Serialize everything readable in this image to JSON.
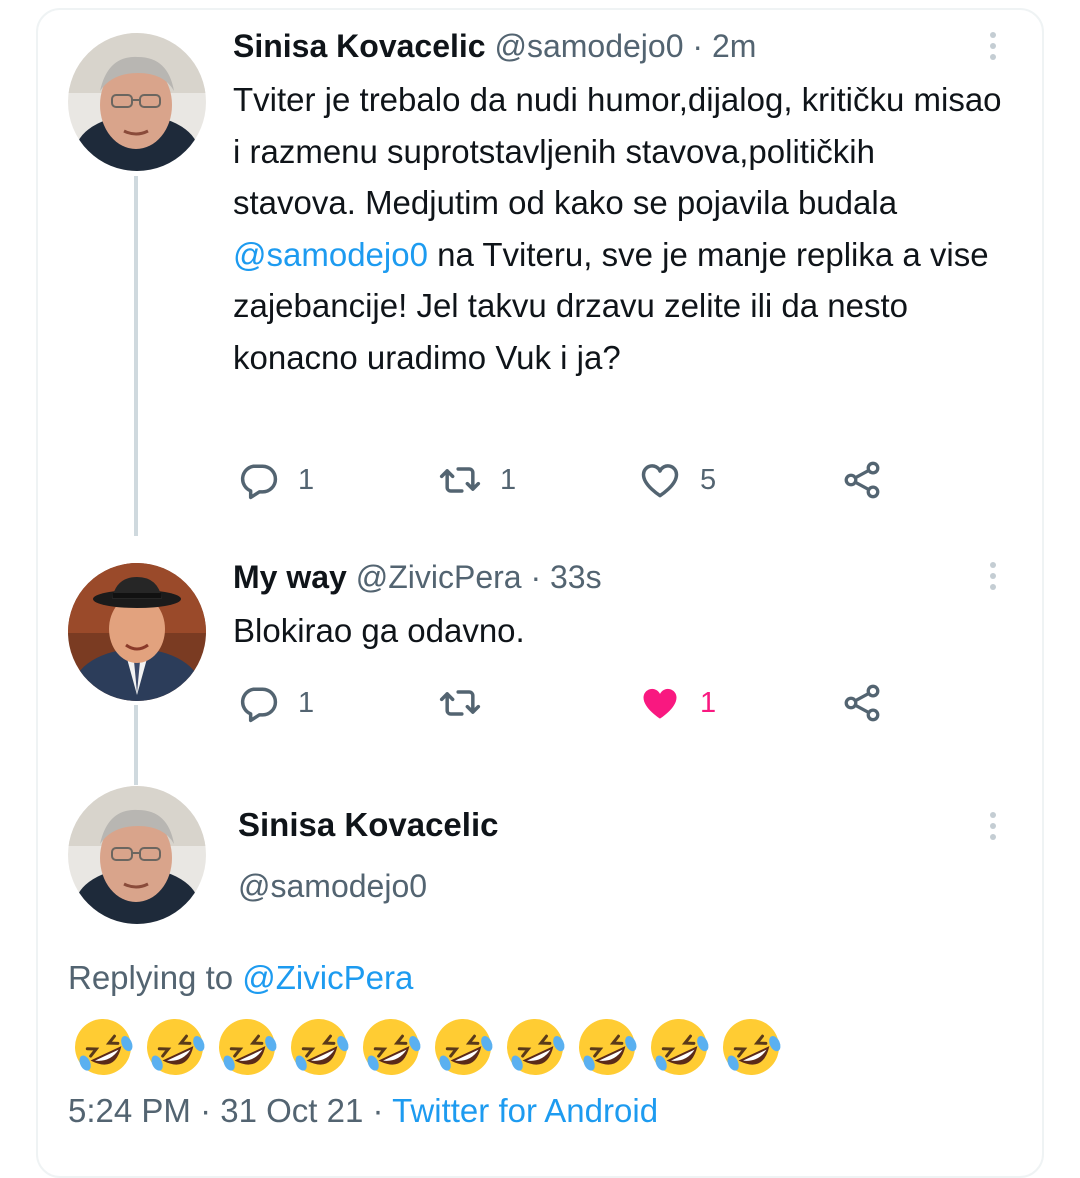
{
  "tweet1": {
    "name": "Sinisa Kovacelic",
    "handle": "@samodejo0",
    "sep": "·",
    "time": "2m",
    "text_1": "Tviter je trebalo da nudi humor,dijalog, kritičku misao i razmenu suprotstavljenih stavova,političkih stavova. Medjutim od kako se pojavila budala ",
    "text_mention": "@samodejo0",
    "text_2": " na Tviteru, sve je manje replika a vise zajebancije! Jel takvu drzavu zelite ili da nesto konacno uradimo Vuk i ja?",
    "replies": "1",
    "retweets": "1",
    "likes": "5"
  },
  "tweet2": {
    "name": "My way",
    "handle": "@ZivicPera",
    "sep": "·",
    "time": "33s",
    "text": "Blokirao ga odavno.",
    "replies": "1",
    "retweets": "",
    "likes": "1"
  },
  "tweet3": {
    "name": "Sinisa Kovacelic",
    "handle": "@samodejo0",
    "replying_prefix": "Replying to ",
    "replying_to": "@ZivicPera",
    "emoji": "🤣🤣🤣🤣🤣🤣🤣🤣🤣🤣",
    "emoji_count": 10,
    "time": "5:24 PM",
    "sep": "·",
    "date": "31 Oct 21",
    "source": "Twitter for Android"
  },
  "icons": {
    "reply": "reply-icon",
    "retweet": "retweet-icon",
    "like": "heart-icon",
    "share": "share-icon",
    "more": "more-vertical-icon"
  },
  "colors": {
    "link": "#1d9bf0",
    "muted": "#536471",
    "like_active": "#f91880"
  }
}
